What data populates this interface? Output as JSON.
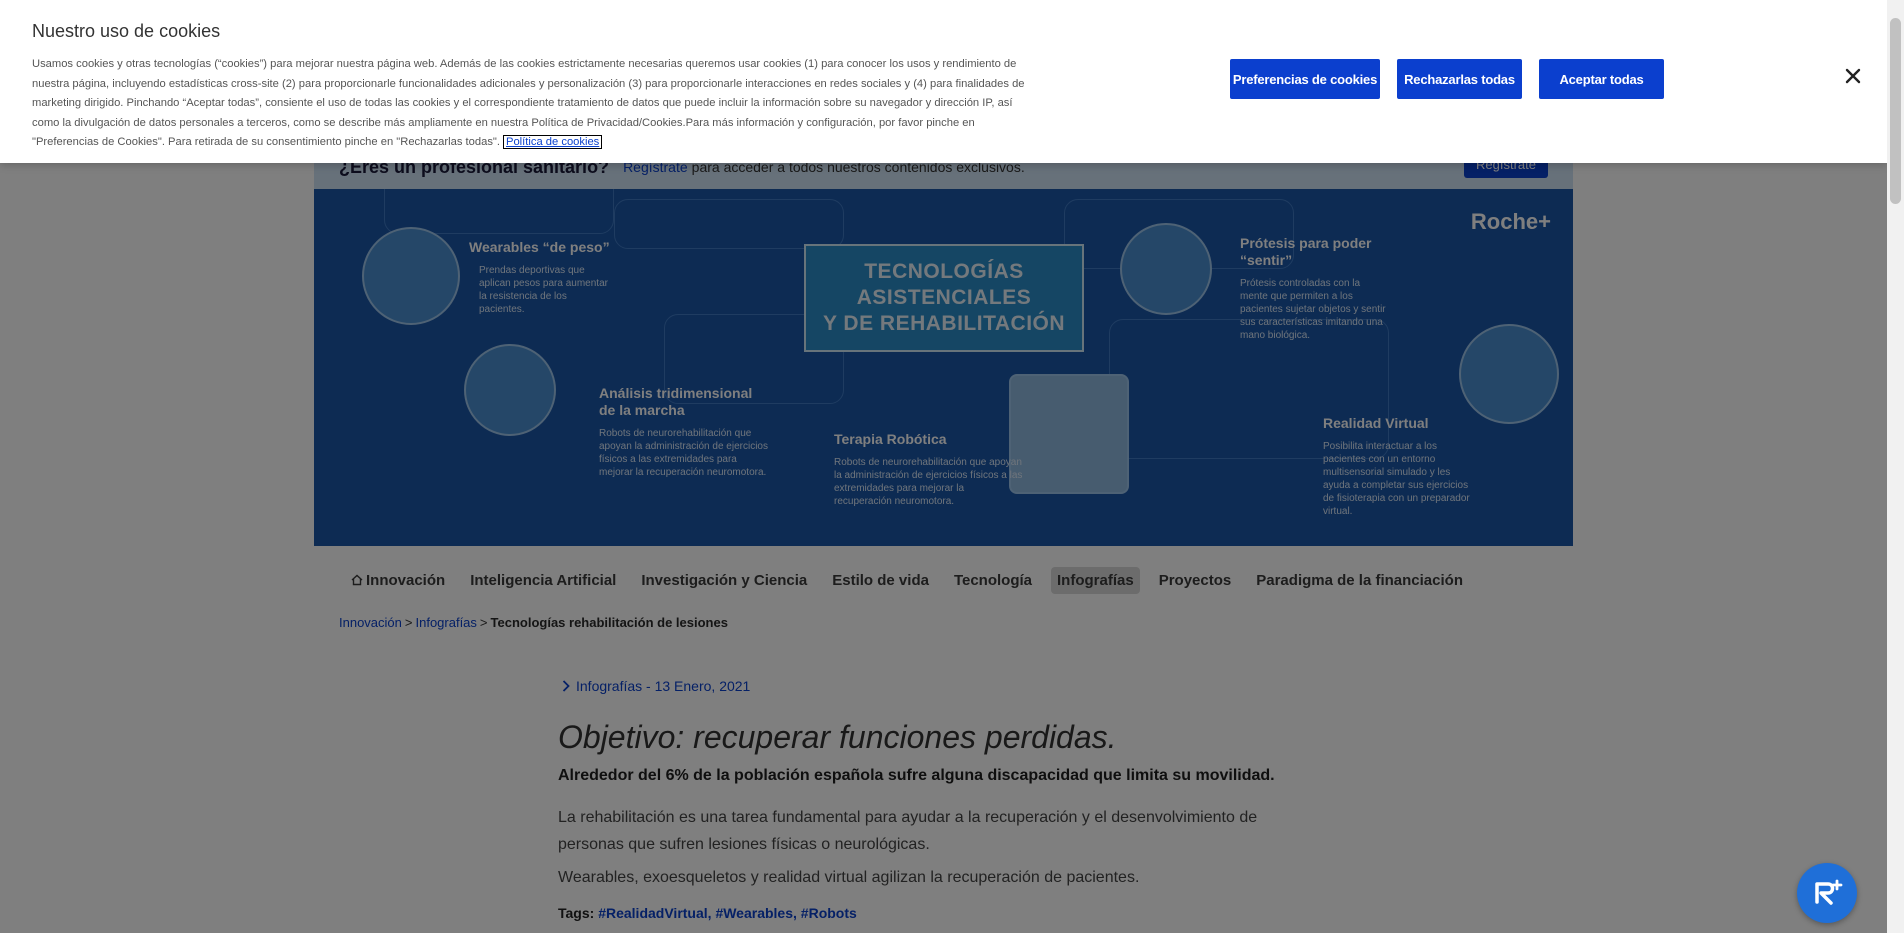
{
  "cookie": {
    "title": "Nuestro uso de cookies",
    "text": "Usamos cookies y otras tecnologías (“cookies”) para mejorar nuestra página web. Además de las cookies estrictamente necesarias queremos usar cookies (1) para conocer los usos y rendimiento de nuestra página, incluyendo estadísticas cross-site (2) para proporcionarle funcionalidades adicionales y personalización (3) para proporcionarle interacciones en redes sociales y (4) para finalidades de marketing dirigido. Pinchando “Aceptar todas”, consiente el uso de todas las cookies y el correspondiente tratamiento de datos que puede incluir la información sobre su navegador y dirección IP, así como la divulgación de datos personales a terceros, como se describe más ampliamente en nuestra Política de Privacidad/Cookies.Para más información y configuración, por favor pinche en \"Preferencias de Cookies\". Para retirada de su consentimiento pinche en \"Rechazarlas todas\".",
    "policy_link": "Política de cookies",
    "preferences_label": "Preferencias de cookies",
    "reject_label": "Rechazarlas todas",
    "accept_label": "Aceptar todas",
    "close_icon": "close-icon"
  },
  "pro_banner": {
    "question": "¿Eres un profesional sanitario?",
    "register_link": "Regístrate",
    "text": "para acceder a todos nuestros contenidos exclusivos.",
    "button": "Regístrate"
  },
  "hero": {
    "logo": "Roche+",
    "title_lines": [
      "TECNOLOGÍAS",
      "ASISTENCIALES",
      "Y DE REHABILITACIÓN"
    ],
    "blocks": [
      {
        "title": "Wearables “de peso”",
        "desc": "Prendas deportivas que aplican pesos para aumentar la resistencia de los pacientes."
      },
      {
        "title": "Análisis tridimensional de la marcha",
        "desc": "Robots de neurorehabilitación que apoyan la administración de ejercicios físicos a las extremidades para mejorar la recuperación neuromotora."
      },
      {
        "title": "Terapia Robótica",
        "desc": "Robots de neurorehabilitación que apoyan la administración de ejercicios físicos a las extremidades para mejorar la recuperación neuromotora."
      },
      {
        "title": "Prótesis para poder “sentir”",
        "desc": "Prótesis controladas con la mente que permiten a los pacientes sujetar objetos y sentir sus características imitando una mano biológica."
      },
      {
        "title": "Realidad Virtual",
        "desc": "Posibilita interactuar a los pacientes con un entorno multisensorial simulado y les ayuda a completar sus ejercicios de fisioterapia con un preparador virtual."
      }
    ]
  },
  "nav": {
    "items": [
      "Innovación",
      "Inteligencia Artificial",
      "Investigación y Ciencia",
      "Estilo de vida",
      "Tecnología",
      "Infografías",
      "Proyectos",
      "Paradigma de la financiación"
    ],
    "active": "Infografías"
  },
  "breadcrumb": {
    "home": "Innovación",
    "section": "Infografías",
    "separator": ">",
    "current": "Tecnologías rehabilitación de lesiones"
  },
  "article": {
    "meta": "Infografías - 13 Enero, 2021",
    "headline": "Objetivo: recuperar funciones perdidas.",
    "lead": "Alrededor del 6% de la población española sufre alguna discapacidad que limita su movilidad.",
    "p1": "La rehabilitación es una tarea fundamental para ayudar a la recuperación y el desenvolvimiento de personas que sufren lesiones físicas o neurológicas.",
    "p2": "Wearables, exoesqueletos y realidad virtual agilizan la recuperación de pacientes.",
    "tags_label": "Tags:",
    "tags": [
      "#RealidadVirtual,",
      "#Wearables,",
      "#Robots"
    ]
  },
  "colors": {
    "accent": "#0b41cd",
    "hero_bg": "#1a56a6",
    "overlay": "rgba(0,0,0,0.5)"
  }
}
